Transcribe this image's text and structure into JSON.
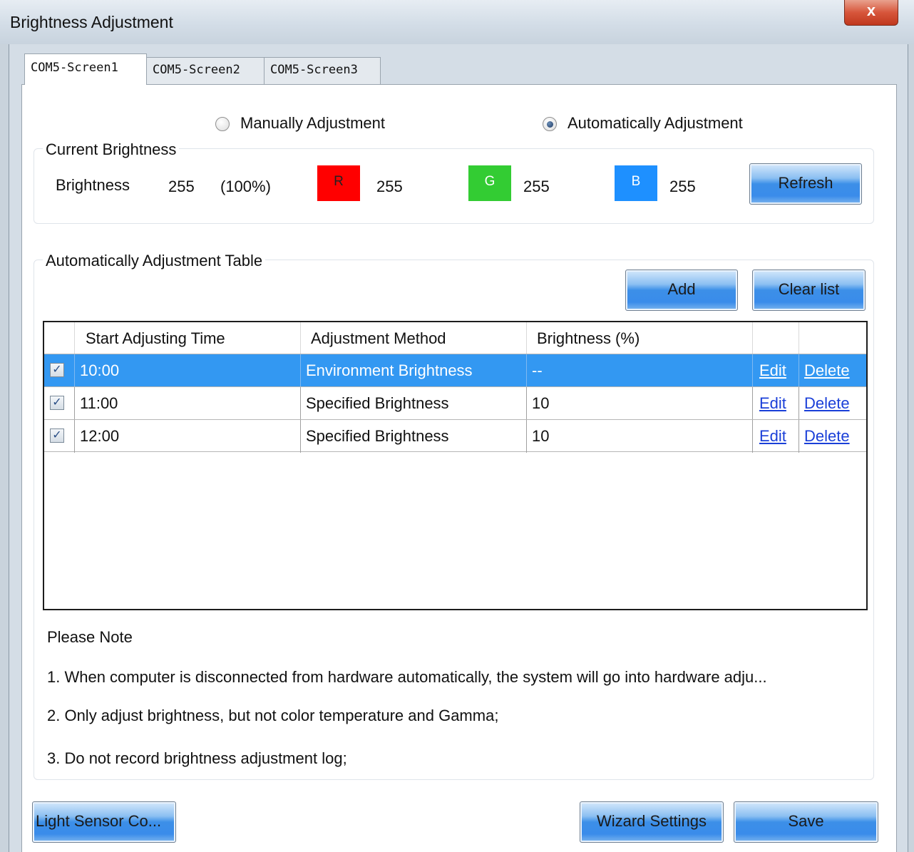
{
  "window": {
    "title": "Brightness Adjustment",
    "close_glyph": "x"
  },
  "tabs": [
    {
      "label": "COM5-Screen1",
      "active": true
    },
    {
      "label": "COM5-Screen2",
      "active": false
    },
    {
      "label": "COM5-Screen3",
      "active": false
    }
  ],
  "mode": {
    "manual_label": "Manually Adjustment",
    "auto_label": "Automatically Adjustment",
    "selected": "auto"
  },
  "current_brightness": {
    "group_title": "Current Brightness",
    "label": "Brightness",
    "value": "255",
    "percent": "(100%)",
    "r_label": "R",
    "r_value": "255",
    "r_color": "#ff0000",
    "g_label": "G",
    "g_value": "255",
    "g_color": "#33cc33",
    "b_label": "B",
    "b_value": "255",
    "b_color": "#1e90ff",
    "refresh_label": "Refresh"
  },
  "auto_table": {
    "group_title": "Automatically Adjustment Table",
    "add_label": "Add",
    "clear_label": "Clear list",
    "columns": [
      "Start Adjusting Time",
      "Adjustment Method",
      "Brightness (%)"
    ],
    "rows": [
      {
        "checked": true,
        "time": "10:00",
        "method": "Environment Brightness",
        "brightness": "--",
        "edit": "Edit",
        "delete": "Delete",
        "selected": true
      },
      {
        "checked": true,
        "time": "11:00",
        "method": "Specified Brightness",
        "brightness": "10",
        "edit": "Edit",
        "delete": "Delete",
        "selected": false
      },
      {
        "checked": true,
        "time": "12:00",
        "method": "Specified Brightness",
        "brightness": "10",
        "edit": "Edit",
        "delete": "Delete",
        "selected": false
      }
    ]
  },
  "notes": {
    "heading": "Please Note",
    "items": [
      "1. When computer is disconnected from hardware automatically, the system will go into hardware adju...",
      "2. Only adjust brightness, but not color temperature and Gamma;",
      "3. Do not record brightness adjustment log;"
    ]
  },
  "footer": {
    "light_sensor_label": "Light Sensor Co...",
    "wizard_label": "Wizard Settings",
    "save_label": "Save"
  },
  "colors": {
    "selected_row": "#3398f2",
    "button_blue": "#3a8cea",
    "link": "#1a3fd8"
  }
}
